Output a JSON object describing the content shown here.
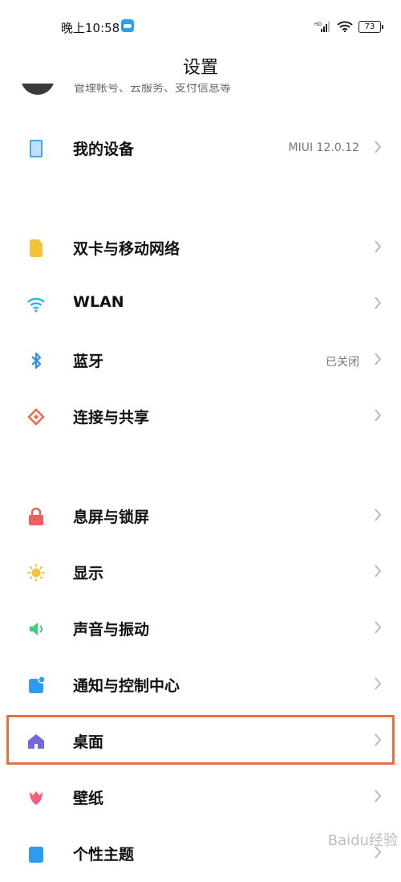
{
  "status_bar": {
    "time": "晚上10:58",
    "battery": "73"
  },
  "title": "设置",
  "account": {
    "subtitle": "管理帐号、云服务、支付信息等"
  },
  "items": [
    {
      "label": "我的设备",
      "value": "MIUI 12.0.12",
      "icon": "device-icon",
      "color": "#4aa6f0"
    },
    {
      "label": "双卡与移动网络",
      "value": "",
      "icon": "sim-card-icon",
      "color": "#f5c23a"
    },
    {
      "label": "WLAN",
      "value": "",
      "icon": "wifi-icon",
      "color": "#2fb4e6"
    },
    {
      "label": "蓝牙",
      "value": "已关闭",
      "icon": "bluetooth-icon",
      "color": "#2f8fe6"
    },
    {
      "label": "连接与共享",
      "value": "",
      "icon": "share-icon",
      "color": "#ec6a4a"
    },
    {
      "label": "息屏与锁屏",
      "value": "",
      "icon": "lock-icon",
      "color": "#ef5f5f"
    },
    {
      "label": "显示",
      "value": "",
      "icon": "sun-icon",
      "color": "#f7c23c"
    },
    {
      "label": "声音与振动",
      "value": "",
      "icon": "speaker-icon",
      "color": "#3ccf7a"
    },
    {
      "label": "通知与控制中心",
      "value": "",
      "icon": "notification-icon",
      "color": "#2f9bf0"
    },
    {
      "label": "桌面",
      "value": "",
      "icon": "home-icon",
      "color": "#7367e0"
    },
    {
      "label": "壁纸",
      "value": "",
      "icon": "tulip-icon",
      "color": "#f0607a"
    },
    {
      "label": "个性主题",
      "value": "",
      "icon": "theme-icon",
      "color": "#2f9bf0"
    }
  ],
  "watermark": "Baidu经验"
}
